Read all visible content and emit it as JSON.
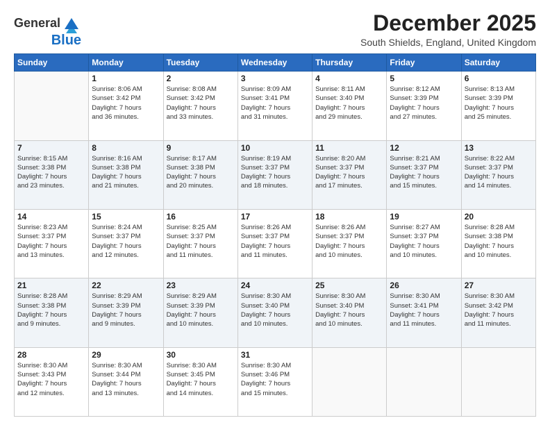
{
  "logo": {
    "line1": "General",
    "line2": "Blue"
  },
  "header": {
    "month": "December 2025",
    "location": "South Shields, England, United Kingdom"
  },
  "weekdays": [
    "Sunday",
    "Monday",
    "Tuesday",
    "Wednesday",
    "Thursday",
    "Friday",
    "Saturday"
  ],
  "weeks": [
    [
      {
        "day": "",
        "info": ""
      },
      {
        "day": "1",
        "info": "Sunrise: 8:06 AM\nSunset: 3:42 PM\nDaylight: 7 hours\nand 36 minutes."
      },
      {
        "day": "2",
        "info": "Sunrise: 8:08 AM\nSunset: 3:42 PM\nDaylight: 7 hours\nand 33 minutes."
      },
      {
        "day": "3",
        "info": "Sunrise: 8:09 AM\nSunset: 3:41 PM\nDaylight: 7 hours\nand 31 minutes."
      },
      {
        "day": "4",
        "info": "Sunrise: 8:11 AM\nSunset: 3:40 PM\nDaylight: 7 hours\nand 29 minutes."
      },
      {
        "day": "5",
        "info": "Sunrise: 8:12 AM\nSunset: 3:39 PM\nDaylight: 7 hours\nand 27 minutes."
      },
      {
        "day": "6",
        "info": "Sunrise: 8:13 AM\nSunset: 3:39 PM\nDaylight: 7 hours\nand 25 minutes."
      }
    ],
    [
      {
        "day": "7",
        "info": "Sunrise: 8:15 AM\nSunset: 3:38 PM\nDaylight: 7 hours\nand 23 minutes."
      },
      {
        "day": "8",
        "info": "Sunrise: 8:16 AM\nSunset: 3:38 PM\nDaylight: 7 hours\nand 21 minutes."
      },
      {
        "day": "9",
        "info": "Sunrise: 8:17 AM\nSunset: 3:38 PM\nDaylight: 7 hours\nand 20 minutes."
      },
      {
        "day": "10",
        "info": "Sunrise: 8:19 AM\nSunset: 3:37 PM\nDaylight: 7 hours\nand 18 minutes."
      },
      {
        "day": "11",
        "info": "Sunrise: 8:20 AM\nSunset: 3:37 PM\nDaylight: 7 hours\nand 17 minutes."
      },
      {
        "day": "12",
        "info": "Sunrise: 8:21 AM\nSunset: 3:37 PM\nDaylight: 7 hours\nand 15 minutes."
      },
      {
        "day": "13",
        "info": "Sunrise: 8:22 AM\nSunset: 3:37 PM\nDaylight: 7 hours\nand 14 minutes."
      }
    ],
    [
      {
        "day": "14",
        "info": "Sunrise: 8:23 AM\nSunset: 3:37 PM\nDaylight: 7 hours\nand 13 minutes."
      },
      {
        "day": "15",
        "info": "Sunrise: 8:24 AM\nSunset: 3:37 PM\nDaylight: 7 hours\nand 12 minutes."
      },
      {
        "day": "16",
        "info": "Sunrise: 8:25 AM\nSunset: 3:37 PM\nDaylight: 7 hours\nand 11 minutes."
      },
      {
        "day": "17",
        "info": "Sunrise: 8:26 AM\nSunset: 3:37 PM\nDaylight: 7 hours\nand 11 minutes."
      },
      {
        "day": "18",
        "info": "Sunrise: 8:26 AM\nSunset: 3:37 PM\nDaylight: 7 hours\nand 10 minutes."
      },
      {
        "day": "19",
        "info": "Sunrise: 8:27 AM\nSunset: 3:37 PM\nDaylight: 7 hours\nand 10 minutes."
      },
      {
        "day": "20",
        "info": "Sunrise: 8:28 AM\nSunset: 3:38 PM\nDaylight: 7 hours\nand 10 minutes."
      }
    ],
    [
      {
        "day": "21",
        "info": "Sunrise: 8:28 AM\nSunset: 3:38 PM\nDaylight: 7 hours\nand 9 minutes."
      },
      {
        "day": "22",
        "info": "Sunrise: 8:29 AM\nSunset: 3:39 PM\nDaylight: 7 hours\nand 9 minutes."
      },
      {
        "day": "23",
        "info": "Sunrise: 8:29 AM\nSunset: 3:39 PM\nDaylight: 7 hours\nand 10 minutes."
      },
      {
        "day": "24",
        "info": "Sunrise: 8:30 AM\nSunset: 3:40 PM\nDaylight: 7 hours\nand 10 minutes."
      },
      {
        "day": "25",
        "info": "Sunrise: 8:30 AM\nSunset: 3:40 PM\nDaylight: 7 hours\nand 10 minutes."
      },
      {
        "day": "26",
        "info": "Sunrise: 8:30 AM\nSunset: 3:41 PM\nDaylight: 7 hours\nand 11 minutes."
      },
      {
        "day": "27",
        "info": "Sunrise: 8:30 AM\nSunset: 3:42 PM\nDaylight: 7 hours\nand 11 minutes."
      }
    ],
    [
      {
        "day": "28",
        "info": "Sunrise: 8:30 AM\nSunset: 3:43 PM\nDaylight: 7 hours\nand 12 minutes."
      },
      {
        "day": "29",
        "info": "Sunrise: 8:30 AM\nSunset: 3:44 PM\nDaylight: 7 hours\nand 13 minutes."
      },
      {
        "day": "30",
        "info": "Sunrise: 8:30 AM\nSunset: 3:45 PM\nDaylight: 7 hours\nand 14 minutes."
      },
      {
        "day": "31",
        "info": "Sunrise: 8:30 AM\nSunset: 3:46 PM\nDaylight: 7 hours\nand 15 minutes."
      },
      {
        "day": "",
        "info": ""
      },
      {
        "day": "",
        "info": ""
      },
      {
        "day": "",
        "info": ""
      }
    ]
  ]
}
